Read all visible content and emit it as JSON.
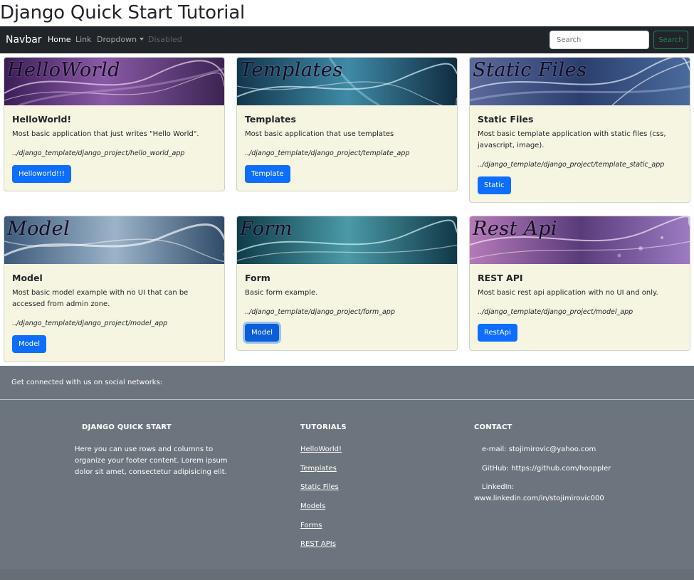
{
  "page_title": "Django Quick Start Tutorial",
  "navbar": {
    "brand": "Navbar",
    "links": {
      "home": "Home",
      "link": "Link",
      "dropdown": "Dropdown",
      "disabled": "Disabled"
    },
    "search_placeholder": "Search",
    "search_button": "Search"
  },
  "cards": [
    {
      "banner_text": "HelloWorld",
      "title": "HelloWorld!",
      "description": "Most basic application that just writes \"Hello World\".",
      "path": "../django_template/django_project/hello_world_app",
      "button": "Helloworld!!!"
    },
    {
      "banner_text": "Templates",
      "title": "Templates",
      "description": "Most basic application that use templates",
      "path": "../django_template/django_project/template_app",
      "button": "Template"
    },
    {
      "banner_text": "Static Files",
      "title": "Static Files",
      "description": "Most basic template application with static files (css, javascript, image).",
      "path": "../django_template/django_project/template_static_app",
      "button": "Static"
    },
    {
      "banner_text": "Model",
      "title": "Model",
      "description": "Most basic model example with no UI that can be accessed from admin zone.",
      "path": "../django_template/django_project/model_app",
      "button": "Model"
    },
    {
      "banner_text": "Form",
      "title": "Form",
      "description": "Basic form example.",
      "path": "../django_template/django_project/form_app",
      "button": "Model"
    },
    {
      "banner_text": "Rest Api",
      "title": "REST API",
      "description": "Most basic rest api application with no UI and only.",
      "path": "../django_template/django_project/model_app",
      "button": "RestApi"
    }
  ],
  "footer": {
    "social_text": "Get connected with us on social networks:",
    "about": {
      "heading": "DJANGO QUICK START",
      "text": "Here you can use rows and columns to organize your footer content. Lorem ipsum dolor sit amet, consectetur adipisicing elit."
    },
    "tutorials": {
      "heading": "TUTORIALS",
      "links": [
        "HelloWorld!",
        "Templates",
        "Static Files",
        "Models",
        "Forms",
        "REST APIs"
      ]
    },
    "contact": {
      "heading": "CONTACT",
      "email": "e-mail: stojimirovic@yahoo.com",
      "github": "GitHub: https://github.com/hooppler",
      "linkedin_label": "LinkedIn:",
      "linkedin_url": "www.linkedin.com/in/stojimirovic000"
    }
  }
}
